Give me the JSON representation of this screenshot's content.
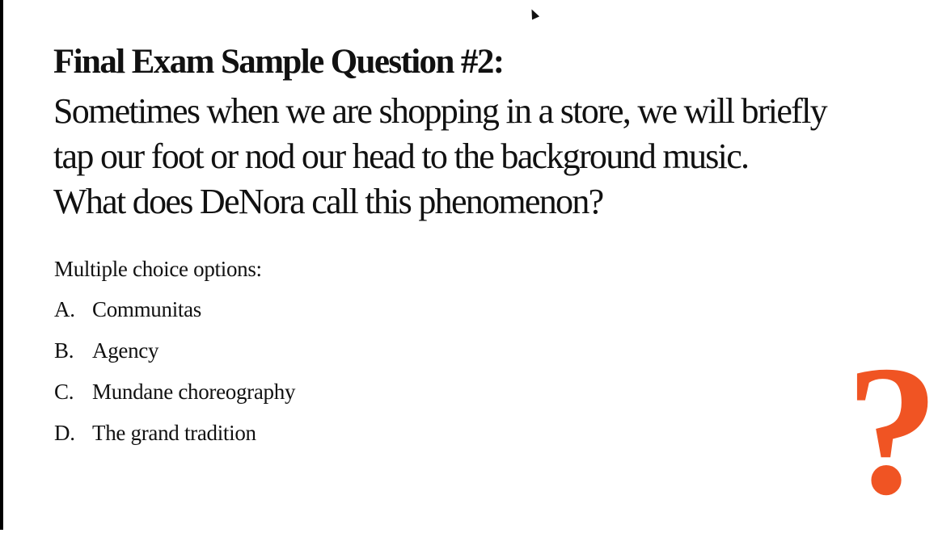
{
  "slide": {
    "title": "Final Exam Sample Question #2:",
    "question_lines": [
      "Sometimes when we are shopping in a store, we will briefly",
      "tap our foot or nod our head to the background music.",
      "What does DeNora call this phenomenon?"
    ],
    "options_label": "Multiple choice options:",
    "options": [
      {
        "letter": "A.",
        "text": "Communitas"
      },
      {
        "letter": "B.",
        "text": "Agency"
      },
      {
        "letter": "C.",
        "text": "Mundane choreography"
      },
      {
        "letter": "D.",
        "text": "The grand tradition"
      }
    ],
    "decoration": {
      "glyph": "?",
      "color": "#f05423"
    }
  }
}
